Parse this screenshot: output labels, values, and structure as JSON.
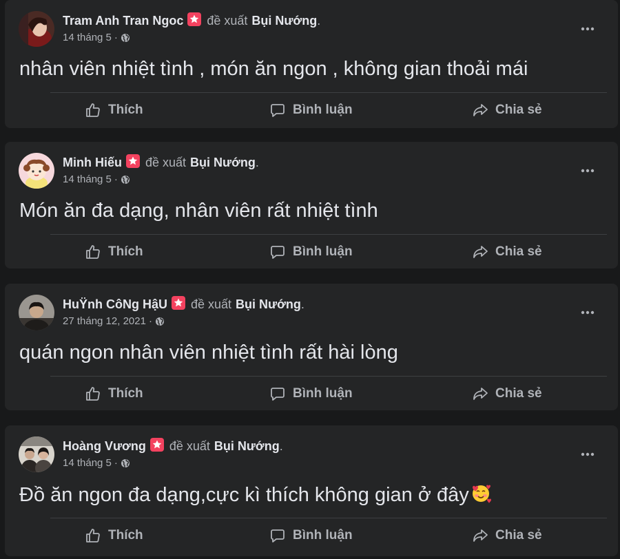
{
  "ui": {
    "recommend_text": "đề xuất",
    "like_label": "Thích",
    "comment_label": "Bình luận",
    "share_label": "Chia sẻ"
  },
  "posts": [
    {
      "author": "Tram Anh Tran Ngoc",
      "page": "Bụi Nướng",
      "date": "14 tháng 5",
      "text": "nhân viên nhiệt tình , món ăn ngon , không gian thoải mái"
    },
    {
      "author": "Minh Hiếu",
      "page": "Bụi Nướng",
      "date": "14 tháng 5",
      "text": "Món ăn đa dạng, nhân viên rất nhiệt tình"
    },
    {
      "author": "HuŸnh CôNg HậU",
      "page": "Bụi Nướng",
      "date": "27 tháng 12, 2021",
      "text": "quán ngon nhân viên nhiệt tình rất hài lòng"
    },
    {
      "author": "Hoàng Vương",
      "page": "Bụi Nướng",
      "date": "14 tháng 5",
      "text": "Đồ ăn ngon đa dạng,cực kì thích không gian ở đây",
      "emoji": "smiling-face-with-hearts"
    }
  ],
  "colors": {
    "background": "#18191a",
    "card": "#242526",
    "primary_text": "#e4e6eb",
    "secondary_text": "#b0b3b8",
    "recommend_badge": "#f3425f",
    "divider": "#3e4042"
  }
}
